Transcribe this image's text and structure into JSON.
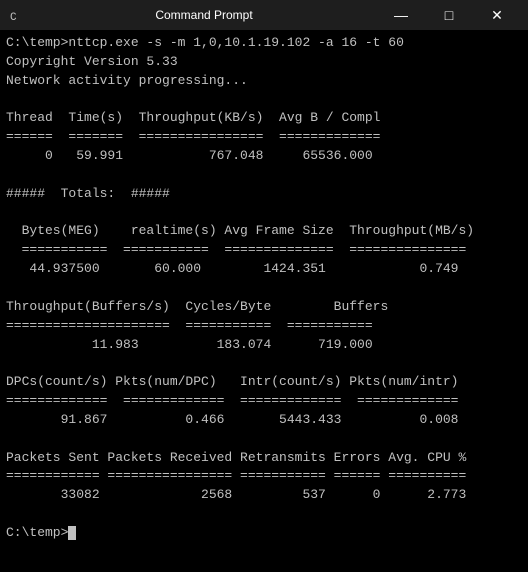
{
  "titlebar": {
    "icon": "▶",
    "title": "Command Prompt",
    "minimize": "—",
    "maximize": "□",
    "close": "✕"
  },
  "terminal": {
    "lines": [
      "C:\\temp>nttcp.exe -s -m 1,0,10.1.19.102 -a 16 -t 60",
      "Copyright Version 5.33",
      "Network activity progressing...",
      "",
      "Thread  Time(s)  Throughput(KB/s)  Avg B / Compl",
      "======  =======  ================  =============",
      "     0   59.991           767.048     65536.000",
      "",
      "#####  Totals:  #####",
      "",
      "  Bytes(MEG)    realtime(s) Avg Frame Size  Throughput(MB/s)",
      "  ===========  ===========  ==============  ===============",
      "   44.937500       60.000        1424.351            0.749",
      "",
      "Throughput(Buffers/s)  Cycles/Byte        Buffers",
      "=====================  ===========  ===========",
      "           11.983          183.074      719.000",
      "",
      "DPCs(count/s) Pkts(num/DPC)   Intr(count/s) Pkts(num/intr)",
      "=============  =============  =============  =============",
      "       91.867          0.466       5443.433          0.008",
      "",
      "Packets Sent Packets Received Retransmits Errors Avg. CPU %",
      "============ ================ =========== ====== ==========",
      "       33082             2568         537      0      2.773",
      "",
      "C:\\temp>"
    ]
  }
}
